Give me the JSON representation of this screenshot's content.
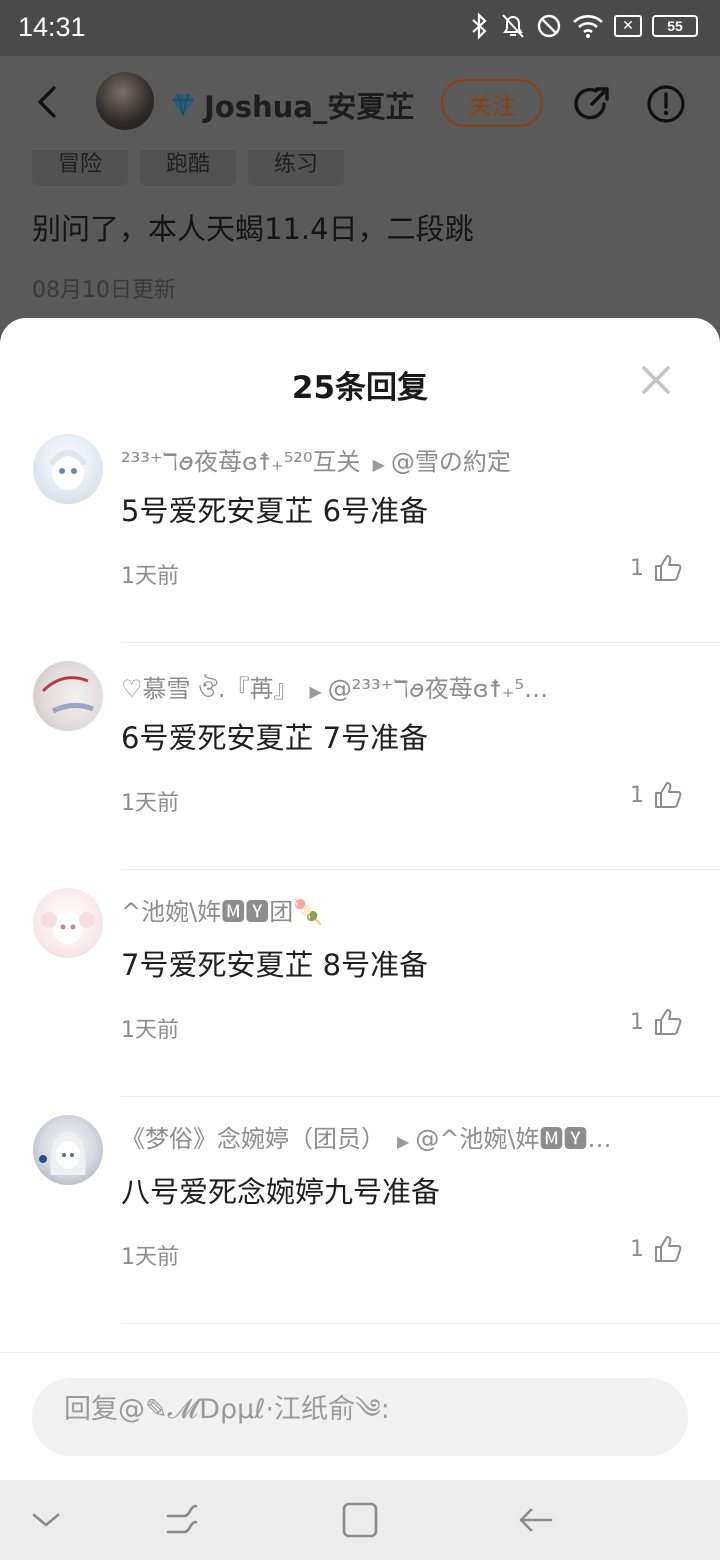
{
  "status": {
    "time": "14:31",
    "battery": "55"
  },
  "header": {
    "username": "Joshua_安夏芷",
    "follow_label": "关注"
  },
  "post": {
    "tags": [
      "冒险",
      "跑酷",
      "练习"
    ],
    "text": "别问了，本人天蝎11.4日，二段跳",
    "date": "08月10日更新"
  },
  "sheet": {
    "title": "25条回复",
    "comments": [
      {
        "author": "²³³⁺ℸꪮ夜苺ɞ☨₊⁵²⁰互关",
        "reply_to": "@雪の約定",
        "text": "5号爱死安夏芷 6号准备",
        "time": "1天前",
        "likes": "1"
      },
      {
        "author": "♡慕雪 ঔ.『苒』",
        "reply_to": "@²³³⁺ℸꪮ夜苺ɞ☨₊⁵…",
        "text": "6号爱死安夏芷 7号准备",
        "time": "1天前",
        "likes": "1"
      },
      {
        "author": "^池婉\\姩🅼🆈团🍡",
        "reply_to": "",
        "text": "7号爱死安夏芷 8号准备",
        "time": "1天前",
        "likes": "1"
      },
      {
        "author": "《梦俗》念婉婷（团员）",
        "reply_to": "@^池婉\\姩🅼🆈…",
        "text": "八号爱死念婉婷九号准备",
        "time": "1天前",
        "likes": "1"
      }
    ]
  },
  "input": {
    "placeholder": "回复@✎𝓜Ɗρµℓ·江纸俞༄:"
  },
  "colors": {
    "accent": "#8a4015",
    "overlay": "#5a5a5a",
    "muted": "#8d8d8d"
  }
}
